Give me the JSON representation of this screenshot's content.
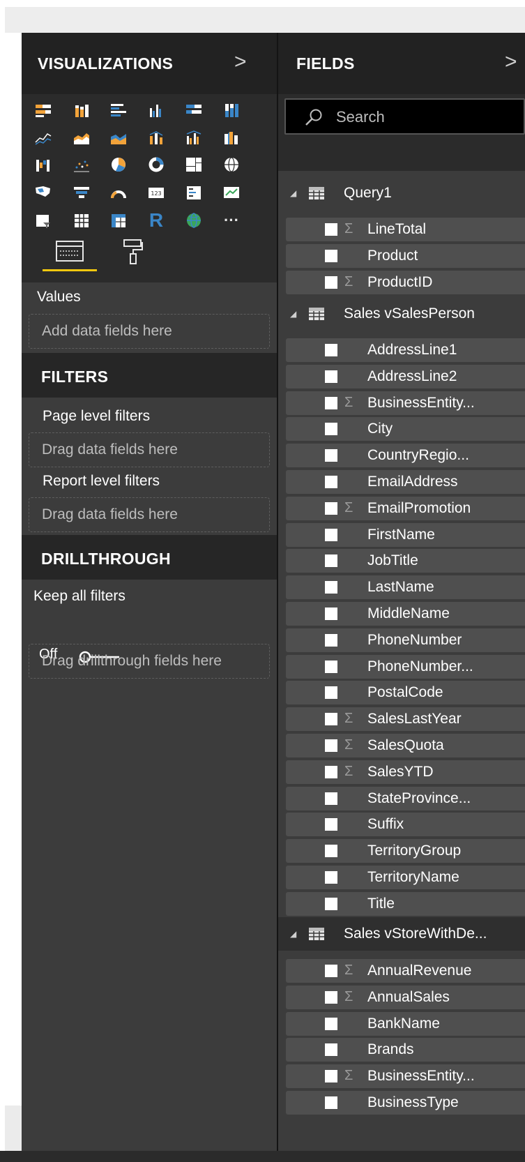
{
  "visualizations": {
    "title": "VISUALIZATIONS",
    "collapse_glyph": ">",
    "icons": [
      "stacked-bar-chart-icon",
      "stacked-column-chart-icon",
      "clustered-bar-chart-icon",
      "clustered-column-chart-icon",
      "100-stacked-bar-chart-icon",
      "100-stacked-column-chart-icon",
      "line-chart-icon",
      "area-chart-icon",
      "stacked-area-chart-icon",
      "line-stacked-column-icon",
      "line-clustered-column-icon",
      "ribbon-chart-icon",
      "waterfall-chart-icon",
      "scatter-chart-icon",
      "pie-chart-icon",
      "donut-chart-icon",
      "treemap-icon",
      "map-icon",
      "filled-map-icon",
      "funnel-icon",
      "gauge-icon",
      "card-icon",
      "multi-row-card-icon",
      "kpi-icon",
      "slicer-icon",
      "table-icon",
      "matrix-icon",
      "r-visual-icon",
      "arcgis-globe-icon",
      "more-visuals-icon"
    ],
    "r_letter": "R",
    "more_glyph": "···",
    "values_label": "Values",
    "values_drop": "Add data fields here"
  },
  "filters": {
    "title": "FILTERS",
    "page_label": "Page level filters",
    "page_drop": "Drag data fields here",
    "report_label": "Report level filters",
    "report_drop": "Drag data fields here"
  },
  "drillthrough": {
    "title": "DRILLTHROUGH",
    "keep_label": "Keep all filters",
    "toggle_state": "Off",
    "drop": "Drag drillthrough fields here"
  },
  "fields_pane": {
    "title": "FIELDS",
    "collapse_glyph": ">",
    "search_placeholder": "Search",
    "tables": [
      {
        "name": "Query1",
        "fields": [
          {
            "name": "LineTotal",
            "sigma": true
          },
          {
            "name": "Product",
            "sigma": false
          },
          {
            "name": "ProductID",
            "sigma": true
          }
        ]
      },
      {
        "name": "Sales vSalesPerson",
        "fields": [
          {
            "name": "AddressLine1",
            "sigma": false
          },
          {
            "name": "AddressLine2",
            "sigma": false
          },
          {
            "name": "BusinessEntity...",
            "sigma": true
          },
          {
            "name": "City",
            "sigma": false
          },
          {
            "name": "CountryRegio...",
            "sigma": false
          },
          {
            "name": "EmailAddress",
            "sigma": false
          },
          {
            "name": "EmailPromotion",
            "sigma": true
          },
          {
            "name": "FirstName",
            "sigma": false
          },
          {
            "name": "JobTitle",
            "sigma": false
          },
          {
            "name": "LastName",
            "sigma": false
          },
          {
            "name": "MiddleName",
            "sigma": false
          },
          {
            "name": "PhoneNumber",
            "sigma": false
          },
          {
            "name": "PhoneNumber...",
            "sigma": false
          },
          {
            "name": "PostalCode",
            "sigma": false
          },
          {
            "name": "SalesLastYear",
            "sigma": true
          },
          {
            "name": "SalesQuota",
            "sigma": true
          },
          {
            "name": "SalesYTD",
            "sigma": true
          },
          {
            "name": "StateProvince...",
            "sigma": false
          },
          {
            "name": "Suffix",
            "sigma": false
          },
          {
            "name": "TerritoryGroup",
            "sigma": false
          },
          {
            "name": "TerritoryName",
            "sigma": false
          },
          {
            "name": "Title",
            "sigma": false
          }
        ]
      },
      {
        "name": "Sales vStoreWithDe...",
        "fields": [
          {
            "name": "AnnualRevenue",
            "sigma": true
          },
          {
            "name": "AnnualSales",
            "sigma": true
          },
          {
            "name": "BankName",
            "sigma": false
          },
          {
            "name": "Brands",
            "sigma": false
          },
          {
            "name": "BusinessEntity...",
            "sigma": true
          },
          {
            "name": "BusinessType",
            "sigma": false
          }
        ]
      }
    ]
  },
  "colors": {
    "accent_tab": "#f2c80f",
    "pane_dark": "#222222",
    "pane_mid": "#3c3c3c",
    "field_row": "#4f4f4f"
  }
}
